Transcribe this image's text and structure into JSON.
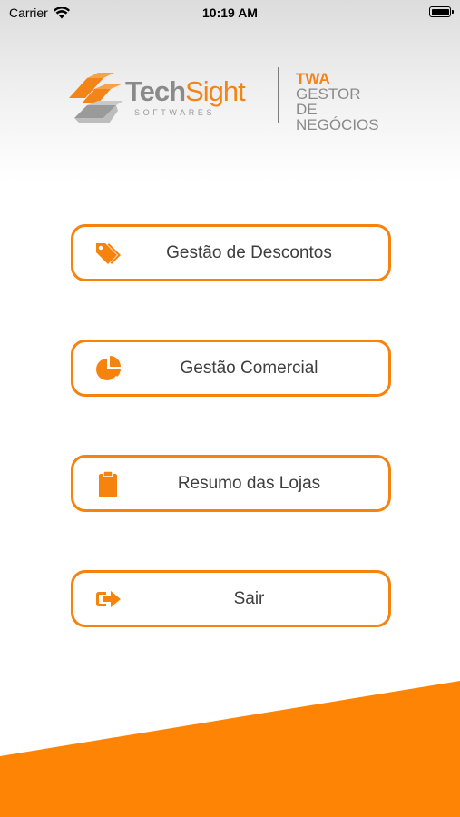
{
  "status_bar": {
    "carrier": "Carrier",
    "time": "10:19 AM"
  },
  "logo": {
    "brand_part1": "Tech",
    "brand_part2": "Sight",
    "tagline": "SOFTWARES",
    "product_line1": "TWA",
    "product_line2": "GESTOR",
    "product_line3": "DE NEGÓCIOS"
  },
  "menu": [
    {
      "label": "Gestão de Descontos",
      "icon": "tags-icon"
    },
    {
      "label": "Gestão Comercial",
      "icon": "pie-chart-icon"
    },
    {
      "label": "Resumo das Lojas",
      "icon": "clipboard-icon"
    },
    {
      "label": "Sair",
      "icon": "sign-out-icon"
    }
  ],
  "colors": {
    "accent": "#f7830f",
    "brand_gray": "#8a8a8a",
    "button_text": "#3e3e3e"
  }
}
